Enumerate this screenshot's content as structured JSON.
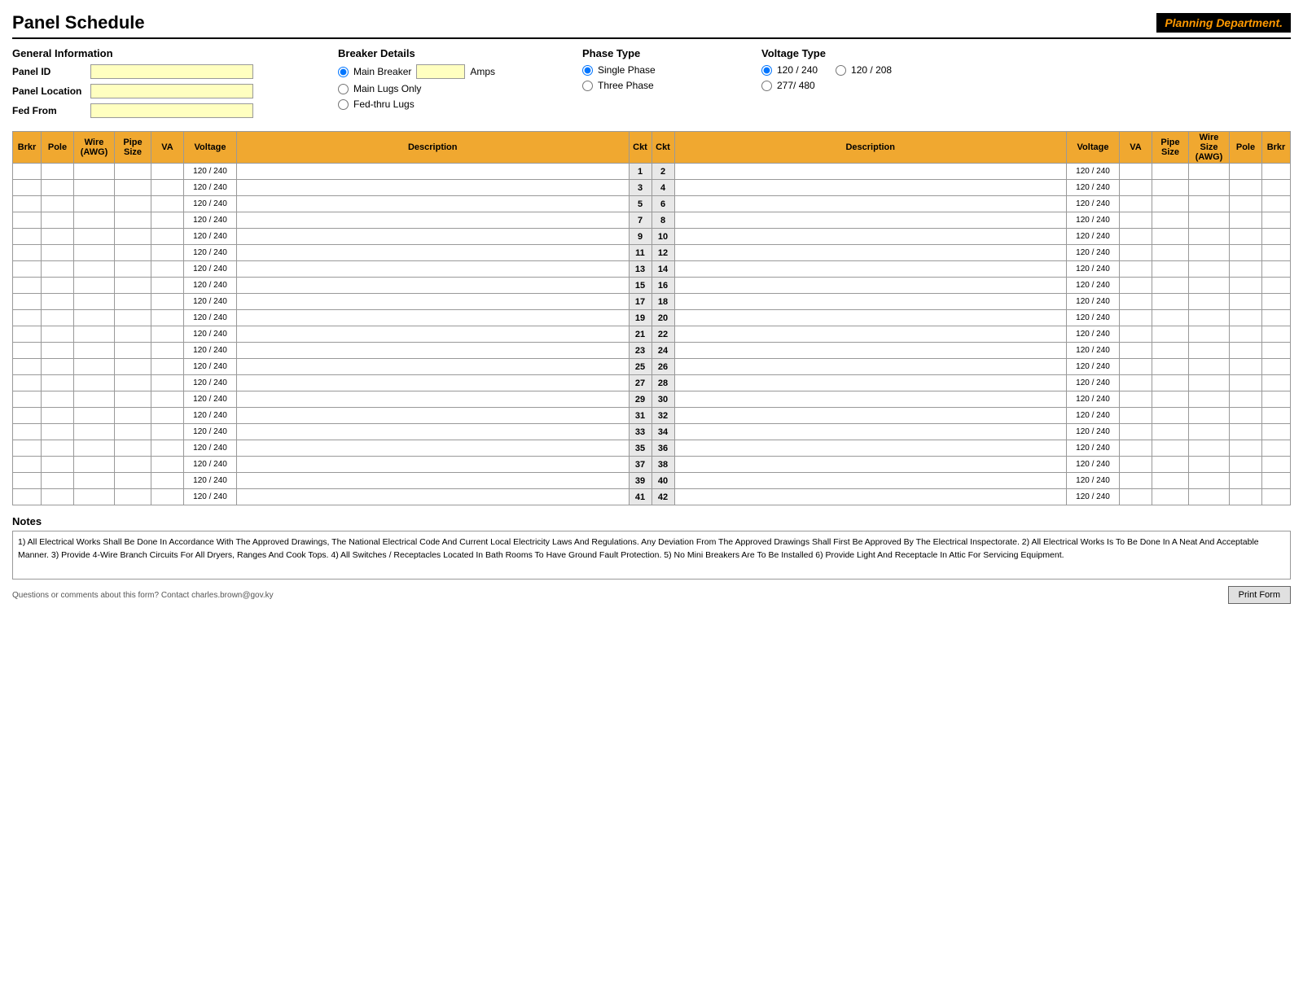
{
  "header": {
    "title": "Panel Schedule",
    "brand_text": "Planning Department."
  },
  "general_info": {
    "section_label": "General Information",
    "panel_id_label": "Panel ID",
    "panel_location_label": "Panel Location",
    "fed_from_label": "Fed From"
  },
  "breaker_details": {
    "section_label": "Breaker Details",
    "main_breaker_label": "Main Breaker",
    "amps_label": "Amps",
    "main_lugs_label": "Main Lugs Only",
    "fed_thru_label": "Fed-thru Lugs"
  },
  "phase_type": {
    "section_label": "Phase Type",
    "single_phase_label": "Single Phase",
    "three_phase_label": "Three Phase"
  },
  "voltage_type": {
    "section_label": "Voltage Type",
    "v120_240_label": "120 / 240",
    "v120_208_label": "120 / 208",
    "v277_480_label": "277/ 480"
  },
  "table": {
    "headers_left": [
      "Brkr",
      "Pole",
      "Wire\n(AWG)",
      "Pipe\nSize",
      "VA",
      "Voltage",
      "Description",
      "Ckt"
    ],
    "headers_right": [
      "Ckt",
      "Description",
      "Voltage",
      "VA",
      "Pipe Size",
      "Wire Size\n(AWG)",
      "Pole",
      "Brkr"
    ],
    "rows": [
      {
        "left_ckt": 1,
        "right_ckt": 2,
        "voltage": "120 / 240"
      },
      {
        "left_ckt": 3,
        "right_ckt": 4,
        "voltage": "120 / 240"
      },
      {
        "left_ckt": 5,
        "right_ckt": 6,
        "voltage": "120 / 240"
      },
      {
        "left_ckt": 7,
        "right_ckt": 8,
        "voltage": "120 / 240"
      },
      {
        "left_ckt": 9,
        "right_ckt": 10,
        "voltage": "120 / 240"
      },
      {
        "left_ckt": 11,
        "right_ckt": 12,
        "voltage": "120 / 240"
      },
      {
        "left_ckt": 13,
        "right_ckt": 14,
        "voltage": "120 / 240"
      },
      {
        "left_ckt": 15,
        "right_ckt": 16,
        "voltage": "120 / 240"
      },
      {
        "left_ckt": 17,
        "right_ckt": 18,
        "voltage": "120 / 240"
      },
      {
        "left_ckt": 19,
        "right_ckt": 20,
        "voltage": "120 / 240"
      },
      {
        "left_ckt": 21,
        "right_ckt": 22,
        "voltage": "120 / 240"
      },
      {
        "left_ckt": 23,
        "right_ckt": 24,
        "voltage": "120 / 240"
      },
      {
        "left_ckt": 25,
        "right_ckt": 26,
        "voltage": "120 / 240"
      },
      {
        "left_ckt": 27,
        "right_ckt": 28,
        "voltage": "120 / 240"
      },
      {
        "left_ckt": 29,
        "right_ckt": 30,
        "voltage": "120 / 240"
      },
      {
        "left_ckt": 31,
        "right_ckt": 32,
        "voltage": "120 / 240"
      },
      {
        "left_ckt": 33,
        "right_ckt": 34,
        "voltage": "120 / 240"
      },
      {
        "left_ckt": 35,
        "right_ckt": 36,
        "voltage": "120 / 240"
      },
      {
        "left_ckt": 37,
        "right_ckt": 38,
        "voltage": "120 / 240"
      },
      {
        "left_ckt": 39,
        "right_ckt": 40,
        "voltage": "120 / 240"
      },
      {
        "left_ckt": 41,
        "right_ckt": 42,
        "voltage": "120 / 240"
      }
    ]
  },
  "notes": {
    "title": "Notes",
    "text": "1) All Electrical Works Shall Be Done In Accordance With The Approved Drawings, The National Electrical Code And Current Local Electricity Laws And Regulations. Any Deviation From The Approved Drawings Shall First Be Approved By The Electrical Inspectorate.  2) All Electrical Works Is To Be Done In A Neat And Acceptable Manner.  3) Provide 4-Wire Branch Circuits For All Dryers, Ranges And Cook Tops.  4) All Switches / Receptacles Located In Bath Rooms To Have Ground Fault Protection.  5) No Mini Breakers Are To Be Installed  6) Provide Light And Receptacle In Attic For Servicing Equipment."
  },
  "footer": {
    "contact": "Questions or comments about this form? Contact charles.brown@gov.ky",
    "print_button": "Print Form"
  }
}
